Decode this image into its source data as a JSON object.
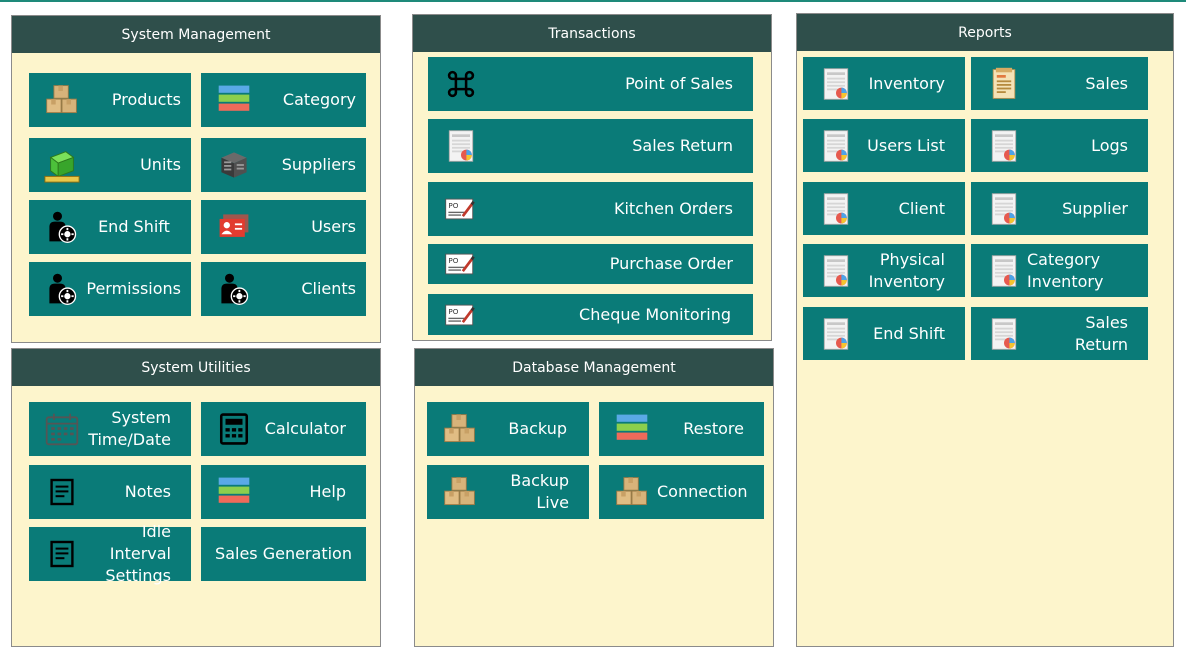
{
  "panels": {
    "system_management": {
      "title": "System Management",
      "tiles": [
        "Products",
        "Category",
        "Units",
        "Suppliers",
        "End Shift",
        "Users",
        "Permissions",
        "Clients"
      ]
    },
    "transactions": {
      "title": "Transactions",
      "tiles": [
        "Point of Sales",
        "Sales Return",
        "Kitchen Orders",
        "Purchase Order",
        "Cheque Monitoring"
      ]
    },
    "reports": {
      "title": "Reports",
      "tiles": [
        "Inventory",
        "Sales",
        "Users List",
        "Logs",
        "Client",
        "Supplier",
        "Physical",
        "Inventory",
        "Category",
        "Inventory",
        "End Shift",
        "Sales Return"
      ]
    },
    "system_utilities": {
      "title": "System Utilities",
      "tiles": [
        "System",
        "Time/Date",
        "Calculator",
        "Notes",
        "Help",
        "Idle Interval",
        "Settings",
        "Sales Generation"
      ]
    },
    "database_management": {
      "title": "Database Management",
      "tiles": [
        "Backup",
        "Restore",
        "Backup Live",
        "Connection"
      ]
    }
  },
  "icons": {
    "boxes": "boxes-icon",
    "category": "category-stack-icon",
    "units": "green-cube-icon",
    "suppliers": "server-cube-icon",
    "person_gear": "user-gear-icon",
    "id_card": "id-card-icon",
    "command": "command-key-icon",
    "report_doc": "report-document-icon",
    "po_doc": "purchase-order-icon",
    "calendar": "calendar-icon",
    "calculator": "calculator-icon",
    "notes": "notes-icon"
  },
  "colors": {
    "tile": "#0a7b78",
    "header": "#2f4f4b",
    "panel_bg": "#fdf5cc",
    "accent_line": "#1e8a7a"
  }
}
